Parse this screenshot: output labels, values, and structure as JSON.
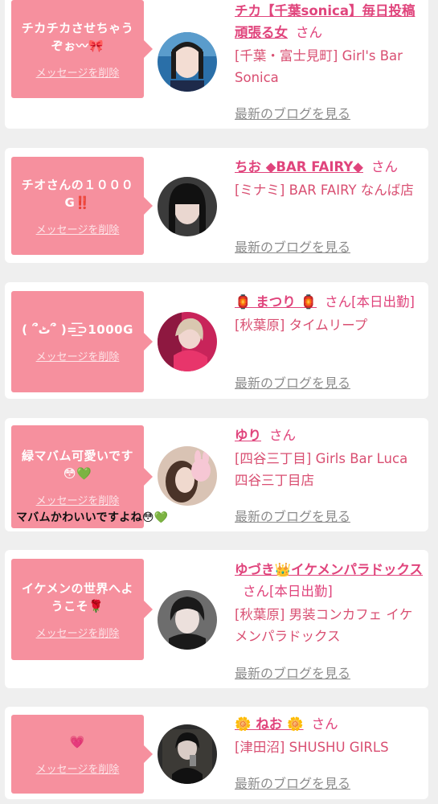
{
  "items": [
    {
      "message": "チカチカさせちゃうぞぉ〰🎀",
      "delete_label": "メッセージを削除",
      "name": "チカ【千葉sonica】毎日投稿頑張る女",
      "honorific": "さん",
      "status": "",
      "shop": "[千葉・富士見町] Girl's Bar Sonica",
      "blog_label": "最新のブログを見る"
    },
    {
      "message": "チオさんの１０００G‼️",
      "delete_label": "メッセージを削除",
      "name": "ちお ◆BAR FAIRY◆",
      "honorific": "さん",
      "status": "",
      "shop": "[ミナミ] BAR FAIRY なんば店",
      "blog_label": "最新のブログを見る"
    },
    {
      "message": "( ՞ٹ՞ )=͟͟͞͞⊃1000G",
      "delete_label": "メッセージを削除",
      "name": "🏮 まつり 🏮",
      "honorific": "さん",
      "status": "[本日出勤]",
      "shop": "[秋葉原] タイムリープ",
      "blog_label": "最新のブログを見る"
    },
    {
      "message": "緑マバム可愛いです😳💚",
      "delete_label": "メッセージを削除",
      "name": "ゆり",
      "honorific": "さん",
      "status": "",
      "shop": "[四谷三丁目] Girls Bar Luca 四谷三丁目店",
      "blog_label": "最新のブログを見る",
      "reply": "マバムかわいいですよね😳💚"
    },
    {
      "message": "イケメンの世界へようこそ🌹",
      "delete_label": "メッセージを削除",
      "name": "ゆづき👑イケメンパラドックス",
      "honorific": "さん",
      "status": "[本日出勤]",
      "shop": "[秋葉原] 男装コンカフェ イケメンパラドックス",
      "blog_label": "最新のブログを見る"
    },
    {
      "message": "💗",
      "delete_label": "メッセージを削除",
      "name": "🌼 ねお 🌼",
      "honorific": "さん",
      "status": "",
      "shop": "[津田沼] SHUSHU GIRLS",
      "blog_label": "最新のブログを見る"
    }
  ],
  "colors": {
    "bubble": "#f6909e",
    "name": "#e0447c",
    "shop": "#d94f72",
    "blog_link": "#8c8c8c",
    "background": "#efefef"
  }
}
